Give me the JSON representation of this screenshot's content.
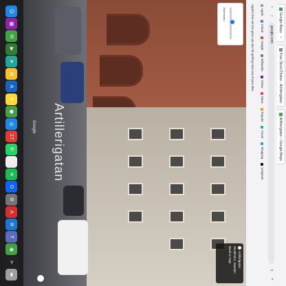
{
  "browser": {
    "tabs": [
      {
        "label": "Google Maps",
        "favicon_color": "#34a853"
      },
      {
        "label": "Free Stock Photos · Artillerigatan"
      },
      {
        "label": "Artillerigatan – Google Maps"
      }
    ],
    "url": "google.com",
    "bookmarks": [
      {
        "label": "Apple",
        "color": "#999999"
      },
      {
        "label": "iCloud",
        "color": "#3b82f6"
      },
      {
        "label": "Google",
        "color": "#ea4335"
      },
      {
        "label": "Wikipedia",
        "color": "#777777"
      },
      {
        "label": "Yahoo",
        "color": "#6b21a8"
      },
      {
        "label": "News",
        "color": "#ef4444"
      },
      {
        "label": "Popular",
        "color": "#f59e0b"
      },
      {
        "label": "Travel",
        "color": "#10b981"
      },
      {
        "label": "Shopping",
        "color": "#0ea5e9"
      },
      {
        "label": "Unsplash",
        "color": "#111111"
      }
    ],
    "notice": "Apple's free service gives you tips for getting more out of your Mac."
  },
  "street_view": {
    "street_label": "Artillerigatan",
    "watermark": "Google",
    "mini_map_label": "Östermalm",
    "place_card": {
      "title": "Artillerigatan",
      "subtitle": "Stockholm, Sweden",
      "action": "Back to map"
    }
  },
  "dock": {
    "apps": [
      {
        "name": "finder-icon",
        "glyph": "☺",
        "color": "#1e88e5"
      },
      {
        "name": "launchpad-icon",
        "glyph": "▦",
        "color": "#8e24aa"
      },
      {
        "name": "messages-icon",
        "glyph": "✉",
        "color": "#43a047"
      },
      {
        "name": "facetime-icon",
        "glyph": "▶",
        "color": "#2e7d32"
      },
      {
        "name": "maps-icon",
        "glyph": "➤",
        "color": "#26a69a"
      },
      {
        "name": "photos-icon",
        "glyph": "✿",
        "color": "#fbc02d"
      },
      {
        "name": "app-store-icon",
        "glyph": "A",
        "color": "#1565c0"
      },
      {
        "name": "notes-icon",
        "glyph": "≡",
        "color": "#fdd835"
      },
      {
        "name": "facetime-icon-2",
        "glyph": "●",
        "color": "#43a047"
      },
      {
        "name": "safari-icon",
        "glyph": "◎",
        "color": "#1e88e5"
      },
      {
        "name": "calendar-icon",
        "glyph": "27",
        "color": "#e53935"
      },
      {
        "name": "whatsapp-icon",
        "glyph": "✆",
        "color": "#25d366"
      },
      {
        "name": "reminders-icon",
        "glyph": "✓",
        "color": "#eeeeee"
      },
      {
        "name": "spotify-icon",
        "glyph": "≋",
        "color": "#1db954"
      },
      {
        "name": "outlook-icon",
        "glyph": "O",
        "color": "#0f62fe"
      },
      {
        "name": "settings-icon",
        "glyph": "⚙",
        "color": "#757575"
      },
      {
        "name": "acrobat-icon",
        "glyph": "A",
        "color": "#d32f2f"
      },
      {
        "name": "mail-icon",
        "glyph": "✉",
        "color": "#1976d2"
      },
      {
        "name": "teams-icon",
        "glyph": "T",
        "color": "#5c6bc0"
      },
      {
        "name": "chrome-icon",
        "glyph": "◉",
        "color": "#43a047"
      },
      {
        "name": "terminal-icon",
        "glyph": ">",
        "color": "#212121"
      },
      {
        "name": "trash-icon",
        "glyph": "▬",
        "color": "#9e9e9e"
      }
    ]
  }
}
